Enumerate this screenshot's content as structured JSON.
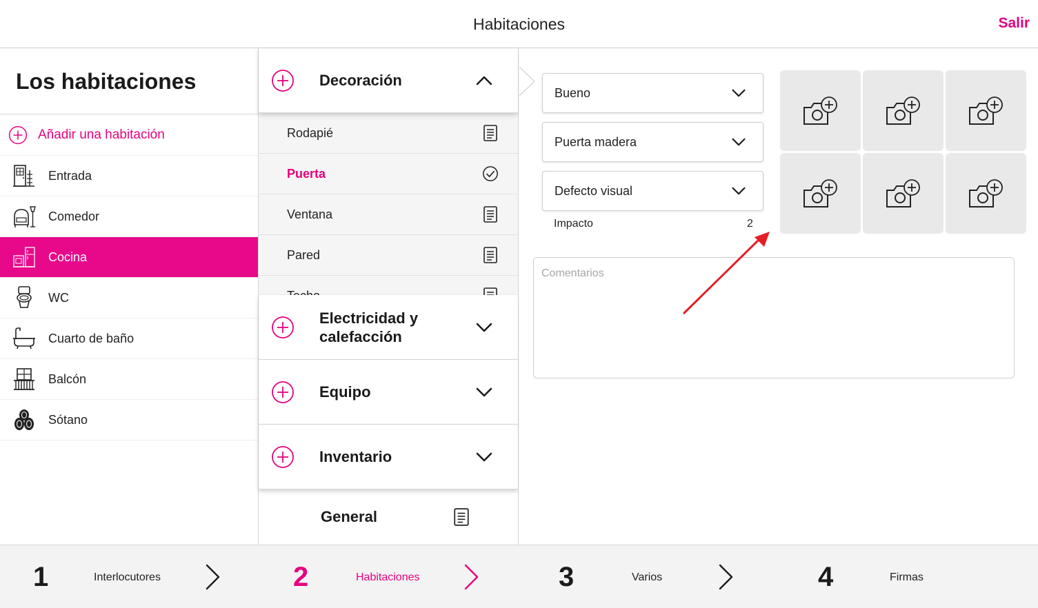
{
  "header": {
    "title": "Habitaciones",
    "logout_label": "Salir"
  },
  "colors": {
    "accent": "#e6007e",
    "active_row": "#e8098b",
    "annotation_arrow": "#e41e26"
  },
  "rooms": {
    "heading": "Los habitaciones",
    "add_label": "Añadir una habitación",
    "items": [
      {
        "label": "Entrada",
        "icon": "door-icon"
      },
      {
        "label": "Comedor",
        "icon": "armchair-lamp-icon"
      },
      {
        "label": "Cocina",
        "icon": "kitchen-icon",
        "active": true
      },
      {
        "label": "WC",
        "icon": "toilet-icon"
      },
      {
        "label": "Cuarto de baño",
        "icon": "bathtub-icon"
      },
      {
        "label": "Balcón",
        "icon": "balcony-icon"
      },
      {
        "label": "Sótano",
        "icon": "barrels-icon"
      }
    ]
  },
  "categories": {
    "decoracion": {
      "label": "Decoración",
      "items": [
        {
          "label": "Rodapié",
          "icon": "note-icon"
        },
        {
          "label": "Puerta",
          "icon": "check-circle-icon",
          "selected": true
        },
        {
          "label": "Ventana",
          "icon": "note-icon"
        },
        {
          "label": "Pared",
          "icon": "note-icon"
        },
        {
          "label": "Techo",
          "icon": "note-icon"
        }
      ]
    },
    "electricidad": {
      "label_line1": "Electricidad y",
      "label_line2": "calefacción"
    },
    "equipo": {
      "label": "Equipo"
    },
    "inventario": {
      "label": "Inventario"
    },
    "general": {
      "label": "General"
    }
  },
  "detail": {
    "condition": "Bueno",
    "type": "Puerta madera",
    "defect": "Defecto visual",
    "impact_label": "Impacto",
    "impact_value": "2",
    "comments_placeholder": "Comentarios",
    "photo_slots": 6
  },
  "stepper": [
    {
      "number": "1",
      "label": "Interlocutores"
    },
    {
      "number": "2",
      "label": "Habitaciones",
      "active": true
    },
    {
      "number": "3",
      "label": "Varios"
    },
    {
      "number": "4",
      "label": "Firmas"
    }
  ]
}
